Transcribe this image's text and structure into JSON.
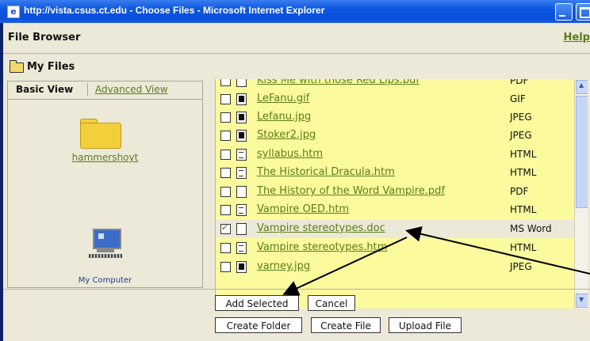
{
  "window": {
    "title": "http://vista.csus.ct.edu - Choose Files - Microsoft Internet Explorer",
    "icon": "ie-page-icon"
  },
  "header": {
    "title": "File Browser",
    "help": "Help"
  },
  "section": {
    "label": "My Files",
    "icon": "folder-open-icon"
  },
  "left_panel": {
    "tabs": {
      "basic": "Basic View",
      "advanced": "Advanced View"
    },
    "folder_link": "hammershoyt",
    "computer_label": "My Computer"
  },
  "files": [
    {
      "name": "Kiss Me with those Red Lips.pdf",
      "type": "PDF",
      "icon": "document-icon",
      "checked": false
    },
    {
      "name": "LeFanu.gif",
      "type": "GIF",
      "icon": "image-icon",
      "checked": false
    },
    {
      "name": "Lefanu.jpg",
      "type": "JPEG",
      "icon": "image-icon",
      "checked": false
    },
    {
      "name": "Stoker2.jpg",
      "type": "JPEG",
      "icon": "image-icon",
      "checked": false
    },
    {
      "name": "syllabus.htm",
      "type": "HTML",
      "icon": "text-document-icon",
      "checked": false
    },
    {
      "name": "The Historical Dracula.htm",
      "type": "HTML",
      "icon": "text-document-icon",
      "checked": false
    },
    {
      "name": "The History of the Word Vampire.pdf",
      "type": "PDF",
      "icon": "document-icon",
      "checked": false
    },
    {
      "name": "Vampire OED.htm",
      "type": "HTML",
      "icon": "text-document-icon",
      "checked": false
    },
    {
      "name": "Vampire stereotypes.doc",
      "type": "MS Word",
      "icon": "document-icon",
      "checked": true
    },
    {
      "name": "Vampire stereotypes.htm",
      "type": "HTML",
      "icon": "text-document-icon",
      "checked": false
    },
    {
      "name": "varney.jpg",
      "type": "JPEG",
      "icon": "image-icon",
      "checked": false
    }
  ],
  "buttons": {
    "add_selected": "Add Selected",
    "cancel": "Cancel",
    "create_folder": "Create Folder",
    "create_file": "Create File",
    "upload_file": "Upload File"
  },
  "colors": {
    "list_bg": "#fbfa9d",
    "link": "#5a7e1a",
    "chrome": "#ece9d8",
    "titlebar": "#0d56df"
  }
}
